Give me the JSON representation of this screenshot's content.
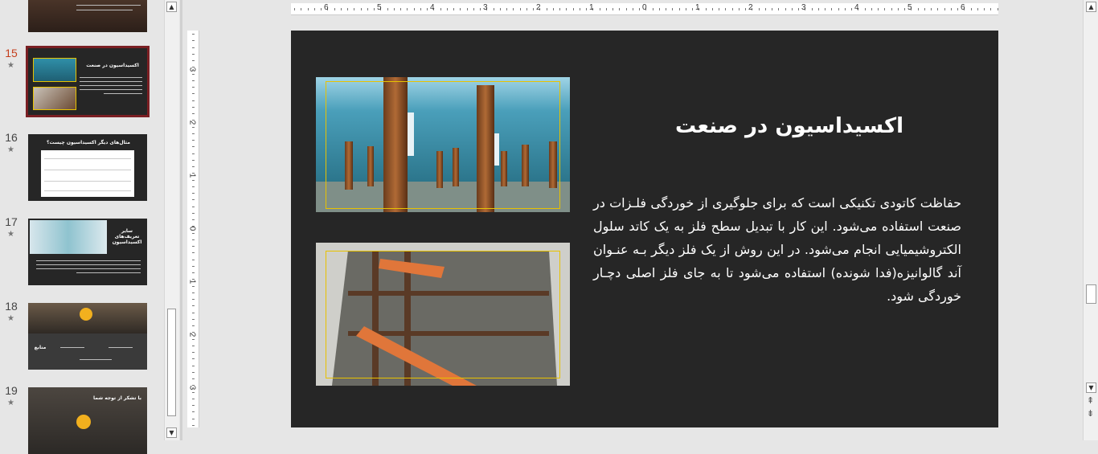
{
  "thumbnails": [
    {
      "number": "",
      "title": ""
    },
    {
      "number": "15",
      "title": "اکسیداسیون در صنعت"
    },
    {
      "number": "16",
      "title": "مثال‌های دیگر اکسیداسیون چیست؟"
    },
    {
      "number": "17",
      "title": "سایر تعریف‌های اکسیداسیون"
    },
    {
      "number": "18",
      "title": "منابع"
    },
    {
      "number": "19",
      "title": "با تشکر از توجه شما"
    }
  ],
  "thumb_star": "★",
  "horizontal_ruler": [
    "6",
    "5",
    "4",
    "3",
    "2",
    "1",
    "0",
    "1",
    "2",
    "3",
    "4",
    "5",
    "6"
  ],
  "vertical_ruler": [
    "3",
    "2",
    "1",
    "0",
    "1",
    "2",
    "3"
  ],
  "slide": {
    "title": "اکسیداسیون در صنعت",
    "body": "حفاظت کاتودی تکنیکی است که برای جلوگیری از خوردگی فلـزات در صنعت استفاده می‌شود. این کار با تبدیل سطح فلز به یک کاتد سلول الکتروشیمیایی انجام می‌شود. در این روش از یک فلز دیگر بـه عنـوان آند گالوانیزه(فدا شونده) استفاده می‌شود تا به جای فلز اصلی دچـار خوردگی شود."
  },
  "scroll_arrows": {
    "up": "▲",
    "down": "▼",
    "prev_slide": "⇞",
    "next_slide": "⇟"
  },
  "colors": {
    "slide_bg": "#262626",
    "selection_outline": "#7a1f23",
    "active_number": "#c43e1c",
    "picture_frame": "#e8c200"
  }
}
